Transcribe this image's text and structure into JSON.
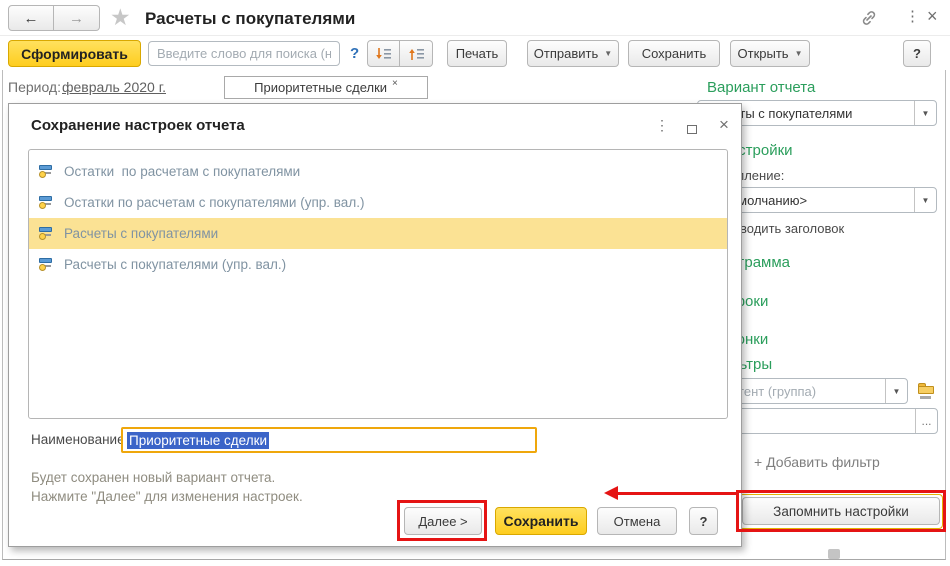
{
  "window": {
    "title": "Расчеты с покупателями",
    "back": "←",
    "forward": "→",
    "close": "×",
    "dots": "⋮"
  },
  "toolbar": {
    "generate": "Сформировать",
    "search_placeholder": "Введите слово для поиска (н...",
    "search_help": "?",
    "print": "Печать",
    "send": "Отправить",
    "save": "Сохранить",
    "open": "Открыть",
    "dropdown_caret": "▼",
    "help": "?"
  },
  "period": {
    "label": "Период:",
    "value": "февраль 2020 г."
  },
  "tag": {
    "label": "Приоритетные сделки",
    "close": "×"
  },
  "sidebar": {
    "variant_heading": "Вариант отчета",
    "variant_value": "Расчеты с покупателями",
    "settings_heading": "Настройки",
    "appearance_label": "Оформление:",
    "appearance_value": "<По умолчанию>",
    "show_title_label": "Выводить заголовок",
    "diagram_heading": "Диаграмма",
    "rows_heading": "Строки",
    "columns_heading": "Колонки",
    "filters_heading": "Фильтры",
    "filter_placeholder": "Контрагент (группа)",
    "ellipsis": "...",
    "add_filter": "+ Добавить фильтр",
    "remember_button": "Запомнить настройки"
  },
  "dialog": {
    "title": "Сохранение настроек отчета",
    "dots": "⋮",
    "close": "×",
    "items": [
      {
        "label": "Остатки  по расчетам с покупателями",
        "selected": false
      },
      {
        "label": "Остатки по расчетам с покупателями (упр. вал.)",
        "selected": false
      },
      {
        "label": "Расчеты с покупателями",
        "selected": true
      },
      {
        "label": "Расчеты с покупателями (упр. вал.)",
        "selected": false
      }
    ],
    "name_label": "Наименование:",
    "name_value": "Приоритетные сделки",
    "info_line1": "Будет сохранен новый вариант отчета.",
    "info_line2": "Нажмите \"Далее\" для изменения настроек.",
    "next_button": "Далее  >",
    "save_button": "Сохранить",
    "cancel_button": "Отмена",
    "help_button": "?"
  },
  "colors": {
    "accent_yellow": "#fecd1f",
    "heading_green": "#2b9e5c",
    "annotation_red": "#e51414",
    "selection_blue": "#3b64c8",
    "list_selection": "#fbe294"
  }
}
